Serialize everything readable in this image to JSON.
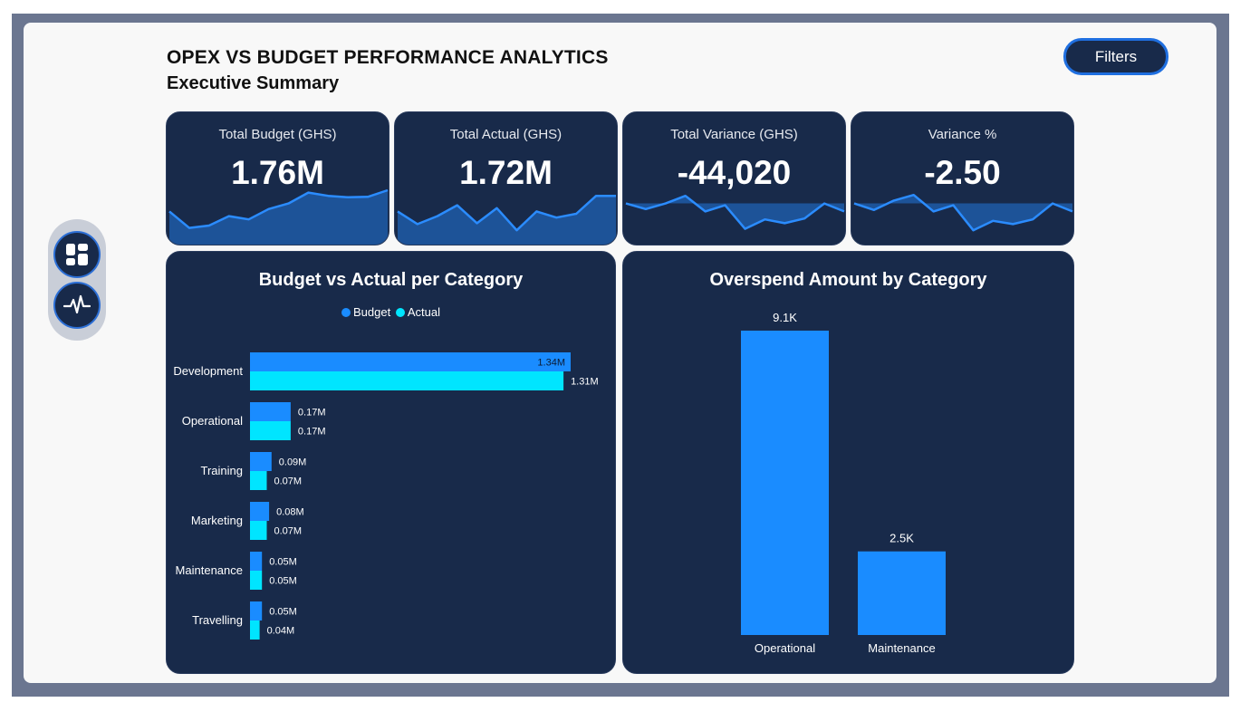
{
  "header": {
    "title": "OPEX VS BUDGET PERFORMANCE ANALYTICS",
    "subtitle": "Executive Summary",
    "filters_label": "Filters"
  },
  "nav": {
    "items": [
      {
        "name": "dashboard",
        "icon": "dashboard-grid-icon"
      },
      {
        "name": "pulse",
        "icon": "pulse-activity-icon"
      }
    ]
  },
  "colors": {
    "card_bg": "#182a4a",
    "budget": "#1a8cff",
    "actual": "#00e5ff",
    "spark_line": "#2b8cff",
    "spark_fill": "#1f5aa6"
  },
  "kpis": [
    {
      "label": "Total Budget (GHS)",
      "value": "1.76M",
      "trend": [
        0.55,
        0.2,
        0.25,
        0.45,
        0.38,
        0.6,
        0.72,
        0.95,
        0.88,
        0.85,
        0.86,
        1.0
      ],
      "fill_mode": "bottom"
    },
    {
      "label": "Total Actual (GHS)",
      "value": "1.72M",
      "trend": [
        0.55,
        0.28,
        0.45,
        0.68,
        0.3,
        0.62,
        0.15,
        0.55,
        0.42,
        0.5,
        0.88,
        0.88
      ],
      "fill_mode": "bottom"
    },
    {
      "label": "Total Variance (GHS)",
      "value": "-44,020",
      "trend": [
        0.72,
        0.6,
        0.72,
        0.88,
        0.55,
        0.68,
        0.18,
        0.38,
        0.3,
        0.4,
        0.72,
        0.55
      ],
      "fill_mode": "baseline"
    },
    {
      "label": "Variance %",
      "value": "-2.50",
      "trend": [
        0.72,
        0.58,
        0.78,
        0.9,
        0.55,
        0.68,
        0.15,
        0.35,
        0.28,
        0.38,
        0.72,
        0.55
      ],
      "fill_mode": "baseline"
    }
  ],
  "chart_data": [
    {
      "type": "bar",
      "orientation": "horizontal",
      "title": "Budget vs Actual per Category",
      "categories": [
        "Development",
        "Operational",
        "Training",
        "Marketing",
        "Maintenance",
        "Travelling"
      ],
      "series": [
        {
          "name": "Budget",
          "values": [
            1.34,
            0.17,
            0.09,
            0.08,
            0.05,
            0.05
          ],
          "labels": [
            "1.34M",
            "0.17M",
            "0.09M",
            "0.08M",
            "0.05M",
            "0.05M"
          ]
        },
        {
          "name": "Actual",
          "values": [
            1.31,
            0.17,
            0.07,
            0.07,
            0.05,
            0.04
          ],
          "labels": [
            "1.31M",
            "0.17M",
            "0.07M",
            "0.07M",
            "0.05M",
            "0.04M"
          ]
        }
      ],
      "xlim": [
        0,
        1.34
      ],
      "legend_position": "top-center",
      "grid": false
    },
    {
      "type": "bar",
      "orientation": "vertical",
      "title": "Overspend Amount by Category",
      "categories": [
        "Operational",
        "Maintenance"
      ],
      "values": [
        9100,
        2500
      ],
      "labels": [
        "9.1K",
        "2.5K"
      ],
      "ylim": [
        0,
        9100
      ],
      "grid": false
    }
  ]
}
